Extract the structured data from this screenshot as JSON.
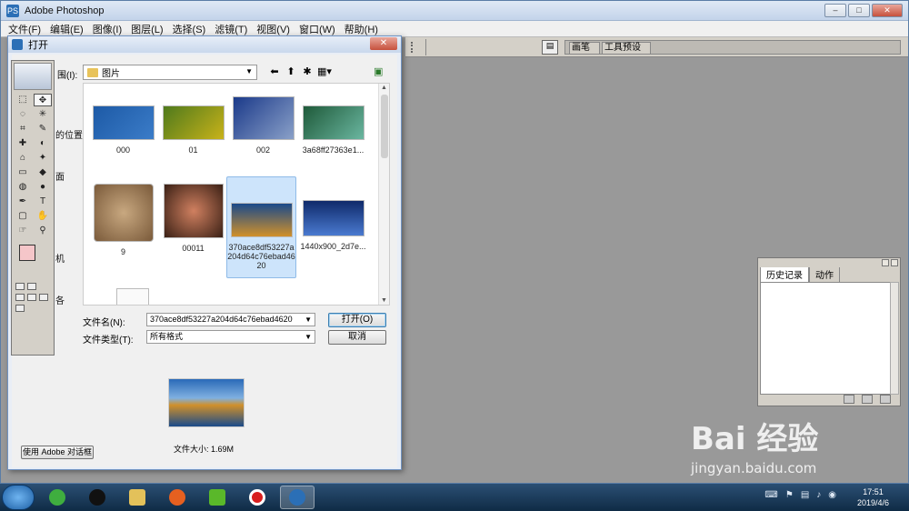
{
  "app": {
    "title": "Adobe Photoshop",
    "logo": "PS",
    "window_controls": [
      "–",
      "□",
      "✕"
    ]
  },
  "menubar": [
    "文件(F)",
    "编辑(E)",
    "图像(I)",
    "图层(L)",
    "选择(S)",
    "滤镜(T)",
    "视图(V)",
    "窗口(W)",
    "帮助(H)"
  ],
  "options_bar": {
    "palette_tabs": [
      "画笔",
      "工具预设"
    ]
  },
  "history_palette": {
    "tabs": [
      "历史记录",
      "动作"
    ]
  },
  "dialog": {
    "title": "打开",
    "close_label": "✕",
    "lookin_label": "围(I):",
    "lookin_value": "图片",
    "places_fragments": [
      "的位置",
      "面",
      "机",
      "各"
    ],
    "files": [
      {
        "name": "000",
        "colors": [
          "#1d5aa6",
          "#3b7cc8"
        ]
      },
      {
        "name": "01",
        "colors": [
          "#4f7a1c",
          "#c8b21a"
        ]
      },
      {
        "name": "002",
        "colors": [
          "#1b3a8a",
          "#8aa0c8"
        ]
      },
      {
        "name": "3a68ff27363e1...",
        "colors": [
          "#1f5a3a",
          "#6ab6a0"
        ]
      },
      {
        "name": "9",
        "colors": [
          "#7a5a3a",
          "#c8a880"
        ]
      },
      {
        "name": "00011",
        "colors": [
          "#3a2015",
          "#d08060"
        ]
      },
      {
        "name": "370ace8df53227a204d64c76ebad4620",
        "colors": [
          "#1a4a8a",
          "#d0902a"
        ],
        "selected": true
      },
      {
        "name": "1440x900_2d7e...",
        "colors": [
          "#0f2a6a",
          "#4a7ad0"
        ]
      }
    ],
    "filename_label": "文件名(N):",
    "filename_value": "370ace8df53227a204d64c76ebad4620",
    "filetype_label": "文件类型(T):",
    "filetype_value": "所有格式",
    "open_button": "打开(O)",
    "cancel_button": "取消",
    "preview_colors": [
      "#1a4a8a",
      "#d0902a"
    ],
    "filesize": "文件大小: 1.69M",
    "adobe_dialog_button": "使用 Adobe 对话框"
  },
  "toolbox": {
    "fg_color": "#f5c6c9",
    "bg_color": "#22a824",
    "tools": [
      "⬚",
      "✥",
      "◌",
      "✳",
      "⌗",
      "✎",
      "✚",
      "◐",
      "⌂",
      "✦",
      "▭",
      "◆",
      "◍",
      "●",
      "✒",
      "T",
      "▢",
      "✋",
      "☞",
      "⚲"
    ]
  },
  "taskbar": {
    "apps": [
      {
        "name": "browser-360",
        "color": "#3fae3f"
      },
      {
        "name": "qq",
        "color": "#111111"
      },
      {
        "name": "file-explorer",
        "color": "#e3c15a"
      },
      {
        "name": "firefox",
        "color": "#e66020"
      },
      {
        "name": "media-player",
        "color": "#5ab82a"
      },
      {
        "name": "screen-recorder",
        "color": "#d81e1e"
      },
      {
        "name": "photoshop",
        "color": "#2b6fb6",
        "active": true
      }
    ],
    "time": "17:51",
    "date": "2019/4/6"
  },
  "watermark": {
    "brand": "Bai 经验",
    "url": "jingyan.baidu.com"
  }
}
